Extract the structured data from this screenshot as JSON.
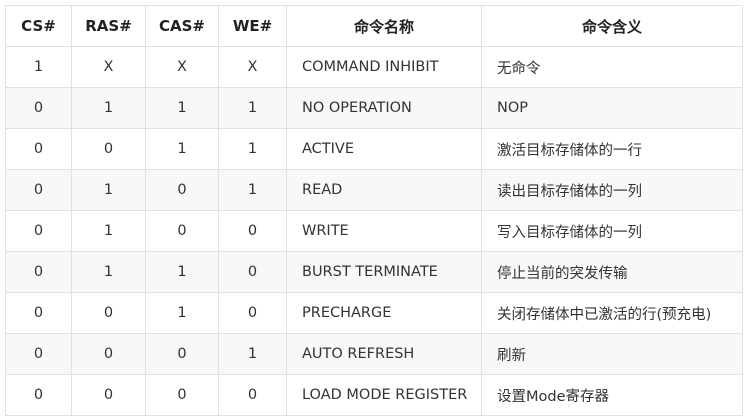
{
  "headers": [
    "CS#",
    "RAS#",
    "CAS#",
    "WE#",
    "命令名称",
    "命令含义"
  ],
  "rows": [
    {
      "cs": "1",
      "ras": "X",
      "cas": "X",
      "we": "X",
      "name": "COMMAND INHIBIT",
      "meaning": "无命令"
    },
    {
      "cs": "0",
      "ras": "1",
      "cas": "1",
      "we": "1",
      "name": "NO OPERATION",
      "meaning": "NOP"
    },
    {
      "cs": "0",
      "ras": "0",
      "cas": "1",
      "we": "1",
      "name": "ACTIVE",
      "meaning": "激活目标存储体的一行"
    },
    {
      "cs": "0",
      "ras": "1",
      "cas": "0",
      "we": "1",
      "name": "READ",
      "meaning": "读出目标存储体的一列"
    },
    {
      "cs": "0",
      "ras": "1",
      "cas": "0",
      "we": "0",
      "name": "WRITE",
      "meaning": "写入目标存储体的一列"
    },
    {
      "cs": "0",
      "ras": "1",
      "cas": "1",
      "we": "0",
      "name": "BURST TERMINATE",
      "meaning": "停止当前的突发传输"
    },
    {
      "cs": "0",
      "ras": "0",
      "cas": "1",
      "we": "0",
      "name": "PRECHARGE",
      "meaning": "关闭存储体中已激活的行(预充电)"
    },
    {
      "cs": "0",
      "ras": "0",
      "cas": "0",
      "we": "1",
      "name": "AUTO REFRESH",
      "meaning": "刷新"
    },
    {
      "cs": "0",
      "ras": "0",
      "cas": "0",
      "we": "0",
      "name": "LOAD MODE REGISTER",
      "meaning": "设置Mode寄存器"
    }
  ],
  "colors": {
    "border": "#dfe2e5",
    "stripe": "#f6f8fa",
    "text": "#333333",
    "header_text": "#222222"
  }
}
